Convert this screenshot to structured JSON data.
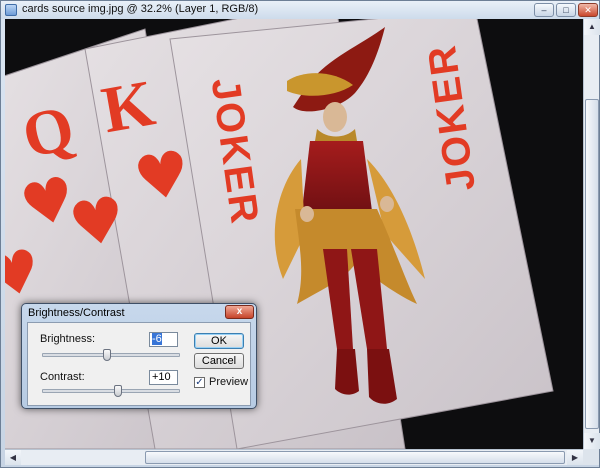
{
  "window": {
    "title": "cards source img.jpg @ 32.2% (Layer 1, RGB/8)",
    "minimize": "–",
    "maximize": "□",
    "close": "✕"
  },
  "canvas": {
    "cards": [
      {
        "rank": "Q",
        "suit": "♥"
      },
      {
        "rank": "K",
        "suit": "♥"
      },
      {
        "rank": "JOKER",
        "suit": ""
      }
    ],
    "joker_rotated": "JOKER",
    "suit_color": "#e23b24"
  },
  "scrollbars": {
    "up": "▲",
    "down": "▼",
    "left": "◀",
    "right": "▶",
    "grip": "⁞⁞⁞"
  },
  "dialog": {
    "title": "Brightness/Contrast",
    "close": "x",
    "brightness_label": "Brightness:",
    "brightness_value": "-6",
    "brightness_level": -6,
    "contrast_label": "Contrast:",
    "contrast_value": "+10",
    "contrast_level": 10,
    "ok_label": "OK",
    "cancel_label": "Cancel",
    "preview_label": "Preview",
    "preview_checked": "✓"
  }
}
